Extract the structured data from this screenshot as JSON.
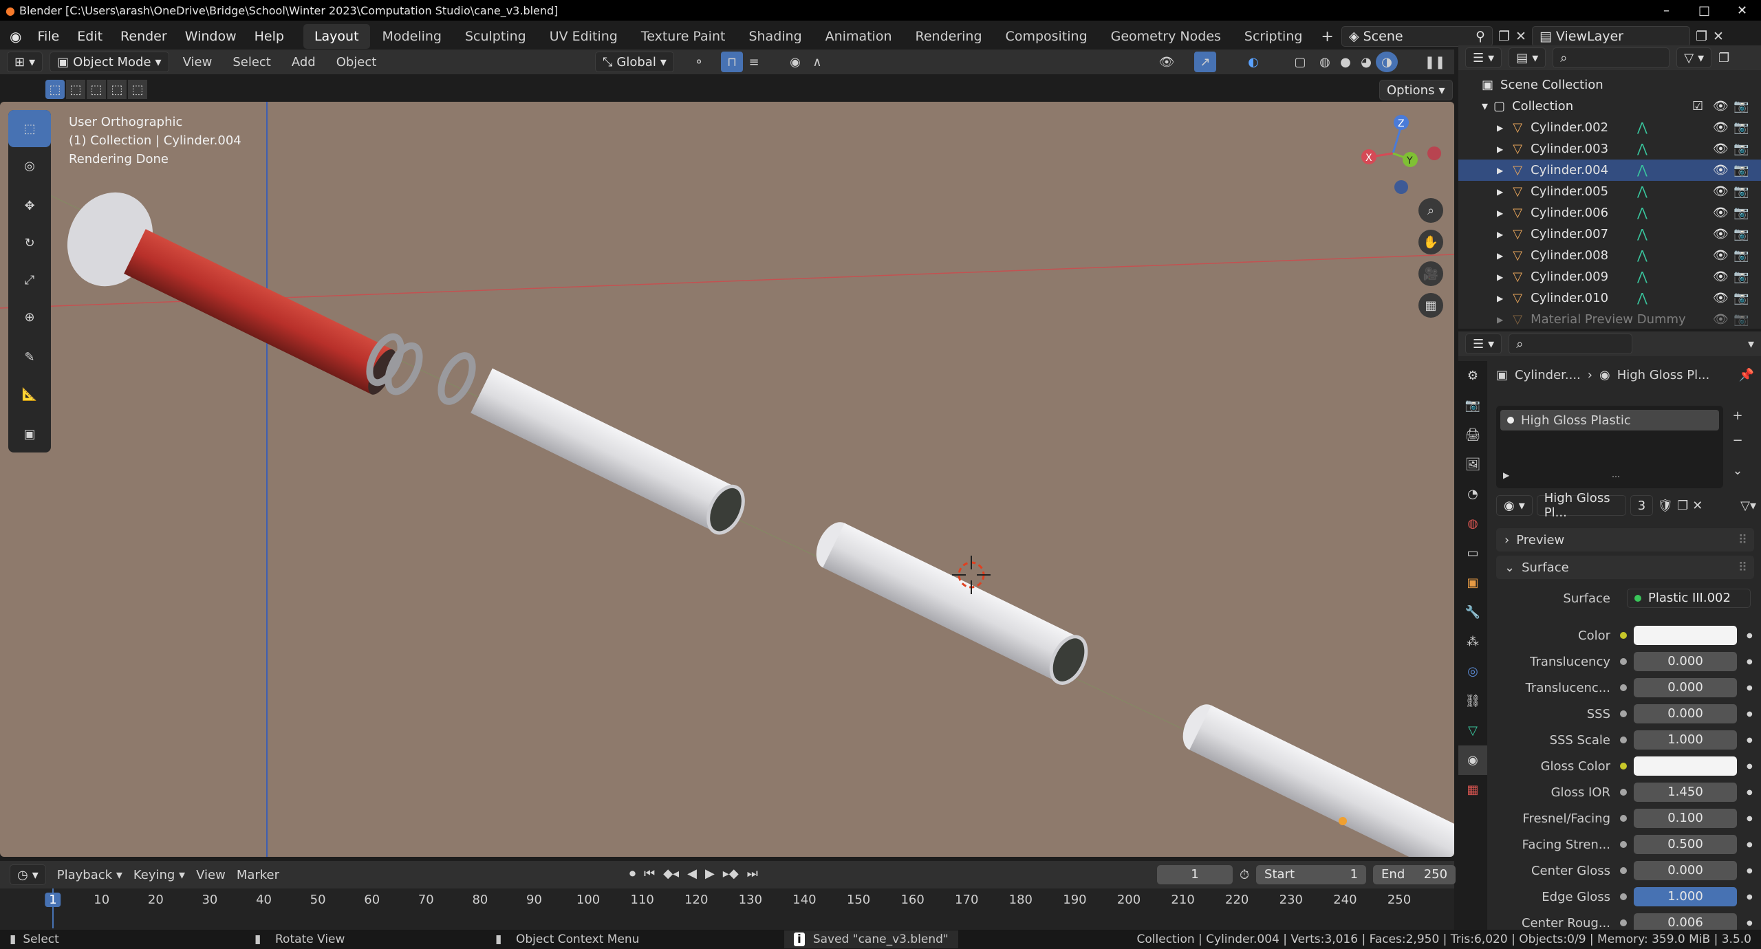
{
  "window": {
    "title": "Blender [C:\\Users\\arash\\OneDrive\\Bridge\\School\\Winter 2023\\Computation Studio\\cane_v3.blend]"
  },
  "menu": [
    "File",
    "Edit",
    "Render",
    "Window",
    "Help"
  ],
  "workspaces": [
    "Layout",
    "Modeling",
    "Sculpting",
    "UV Editing",
    "Texture Paint",
    "Shading",
    "Animation",
    "Rendering",
    "Compositing",
    "Geometry Nodes",
    "Scripting"
  ],
  "scene": {
    "name": "Scene",
    "view_layer": "ViewLayer"
  },
  "viewport_header": {
    "mode": "Object Mode",
    "view": "View",
    "select": "Select",
    "add": "Add",
    "object": "Object",
    "orientation": "Global",
    "options": "Options"
  },
  "viewport_info": {
    "line1": "User Orthographic",
    "line2": "(1) Collection | Cylinder.004",
    "line3": "Rendering Done"
  },
  "gizmo": {
    "x": "X",
    "y": "Y",
    "z": "Z"
  },
  "outliner": {
    "scene_collection": "Scene Collection",
    "collection": "Collection",
    "items": [
      "Cylinder.002",
      "Cylinder.003",
      "Cylinder.004",
      "Cylinder.005",
      "Cylinder.006",
      "Cylinder.007",
      "Cylinder.008",
      "Cylinder.009",
      "Cylinder.010",
      "Material Preview Dummy"
    ]
  },
  "properties": {
    "breadcrumb_object": "Cylinder....",
    "breadcrumb_material": "High Gloss Pl...",
    "slot_name": "High Gloss Plastic",
    "material_name": "High Gloss Pl...",
    "users": "3",
    "panel_preview": "Preview",
    "panel_surface": "Surface",
    "surface_label": "Surface",
    "surface_value": "Plastic III.002",
    "fields": [
      {
        "label": "Color",
        "value": "",
        "socket": "yellow",
        "kind": "color"
      },
      {
        "label": "Translucency",
        "value": "0.000",
        "socket": "grey",
        "kind": "num"
      },
      {
        "label": "Translucenc...",
        "value": "0.000",
        "socket": "grey",
        "kind": "num"
      },
      {
        "label": "SSS",
        "value": "0.000",
        "socket": "grey",
        "kind": "num"
      },
      {
        "label": "SSS Scale",
        "value": "1.000",
        "socket": "grey",
        "kind": "num"
      },
      {
        "label": "Gloss Color",
        "value": "",
        "socket": "yellow",
        "kind": "color"
      },
      {
        "label": "Gloss IOR",
        "value": "1.450",
        "socket": "grey",
        "kind": "num"
      },
      {
        "label": "Fresnel/Facing",
        "value": "0.100",
        "socket": "grey",
        "kind": "num"
      },
      {
        "label": "Facing Stren...",
        "value": "0.500",
        "socket": "grey",
        "kind": "num"
      },
      {
        "label": "Center Gloss",
        "value": "0.000",
        "socket": "grey",
        "kind": "num"
      },
      {
        "label": "Edge Gloss",
        "value": "1.000",
        "socket": "grey",
        "kind": "highlight"
      },
      {
        "label": "Center Roug...",
        "value": "0.006",
        "socket": "grey",
        "kind": "num"
      }
    ]
  },
  "timeline": {
    "playback": "Playback",
    "keying": "Keying",
    "view": "View",
    "marker": "Marker",
    "current_frame": "1",
    "start_label": "Start",
    "start": "1",
    "end_label": "End",
    "end": "250",
    "ticks": [
      "1",
      "10",
      "20",
      "30",
      "40",
      "50",
      "60",
      "70",
      "80",
      "90",
      "100",
      "110",
      "120",
      "130",
      "140",
      "150",
      "160",
      "170",
      "180",
      "190",
      "200",
      "210",
      "220",
      "230",
      "240",
      "250"
    ]
  },
  "statusbar": {
    "select": "Select",
    "rotate": "Rotate View",
    "context": "Object Context Menu",
    "saved": "Saved \"cane_v3.blend\"",
    "info": "Collection | Cylinder.004 | Verts:3,016 | Faces:2,950 | Tris:6,020 | Objects:0/9 | Memory: 359.0 MiB | 3.5.0"
  },
  "colors": {
    "accent": "#4772b3",
    "viewport_bg": "#8e7a6c",
    "red_cane": "#b8302a",
    "mesh_icon": "#39c59d",
    "object_icon": "#e6a45a"
  }
}
